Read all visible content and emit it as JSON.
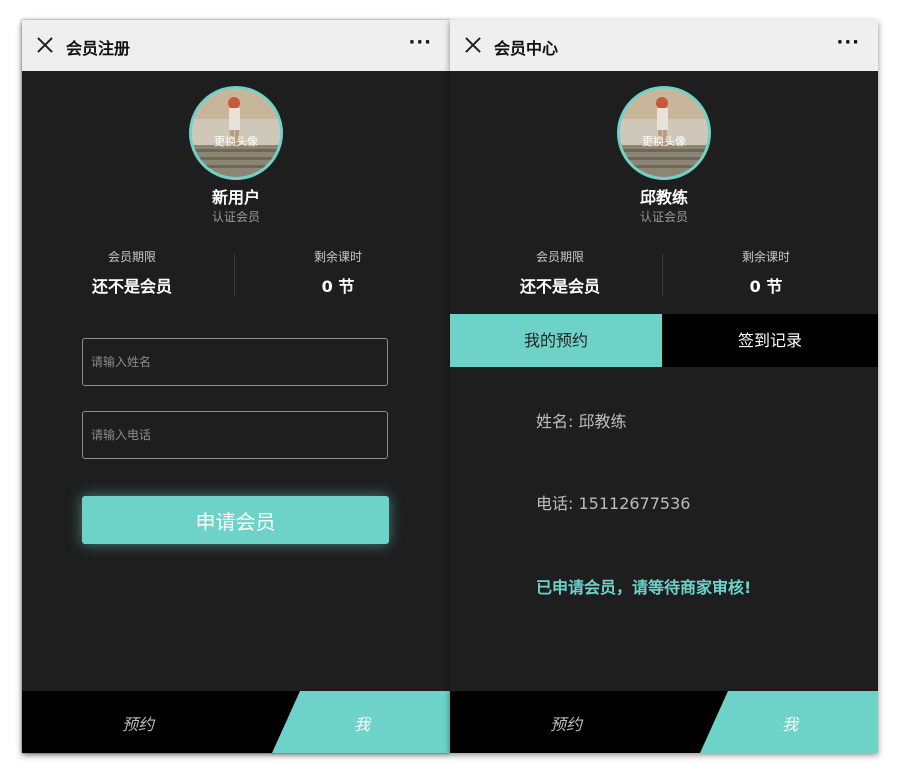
{
  "left_screen": {
    "title": "会员注册",
    "more": "···",
    "avatar_label": "更换头像",
    "user_name": "新用户",
    "user_sub": "认证会员",
    "stats": {
      "period_label": "会员期限",
      "period_value": "还不是会员",
      "remaining_label": "剩余课时",
      "remaining_value": "0 节"
    },
    "form": {
      "name_placeholder": "请输入姓名",
      "phone_placeholder": "请输入电话",
      "submit_label": "申请会员"
    },
    "nav": {
      "left": "预约",
      "right": "我"
    }
  },
  "right_screen": {
    "title": "会员中心",
    "more": "···",
    "avatar_label": "更换头像",
    "user_name": "邱教练",
    "user_sub": "认证会员",
    "stats": {
      "period_label": "会员期限",
      "period_value": "还不是会员",
      "remaining_label": "剩余课时",
      "remaining_value": "0 节"
    },
    "tabs": {
      "active": "我的预约",
      "other": "签到记录"
    },
    "booking": {
      "name_line": "姓名: 邱教练",
      "phone_line": "电话: 15112677536",
      "notice": "已申请会员，请等待商家审核!"
    },
    "nav": {
      "left": "预约",
      "right": "我"
    }
  },
  "colors": {
    "accent": "#6dd3c9",
    "background": "#1e1e1e",
    "titlebar": "#efefef",
    "nav_bg": "#000000"
  },
  "icons": [
    "close-icon",
    "more-icon",
    "avatar-image"
  ]
}
